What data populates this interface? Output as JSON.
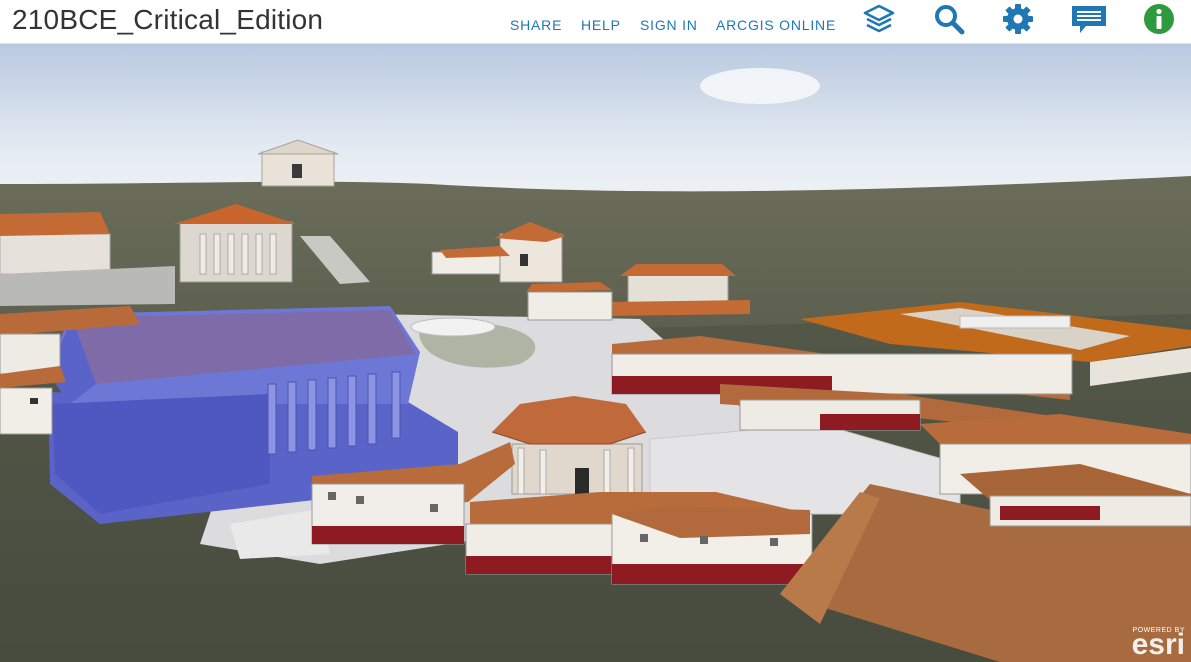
{
  "header": {
    "title": "210BCE_Critical_Edition",
    "links": {
      "share": "SHARE",
      "help": "HELP",
      "sign_in": "SIGN IN",
      "arcgis_online": "ARCGIS ONLINE"
    },
    "tools": [
      "layers-icon",
      "search-icon",
      "settings-gear-icon",
      "comment-icon",
      "info-icon"
    ],
    "colors": {
      "link": "#1f77b4",
      "accent": "#1f77b4",
      "info_green": "#2e9a3e"
    }
  },
  "attribution": {
    "powered_by": "POWERED BY",
    "brand": "esri"
  }
}
